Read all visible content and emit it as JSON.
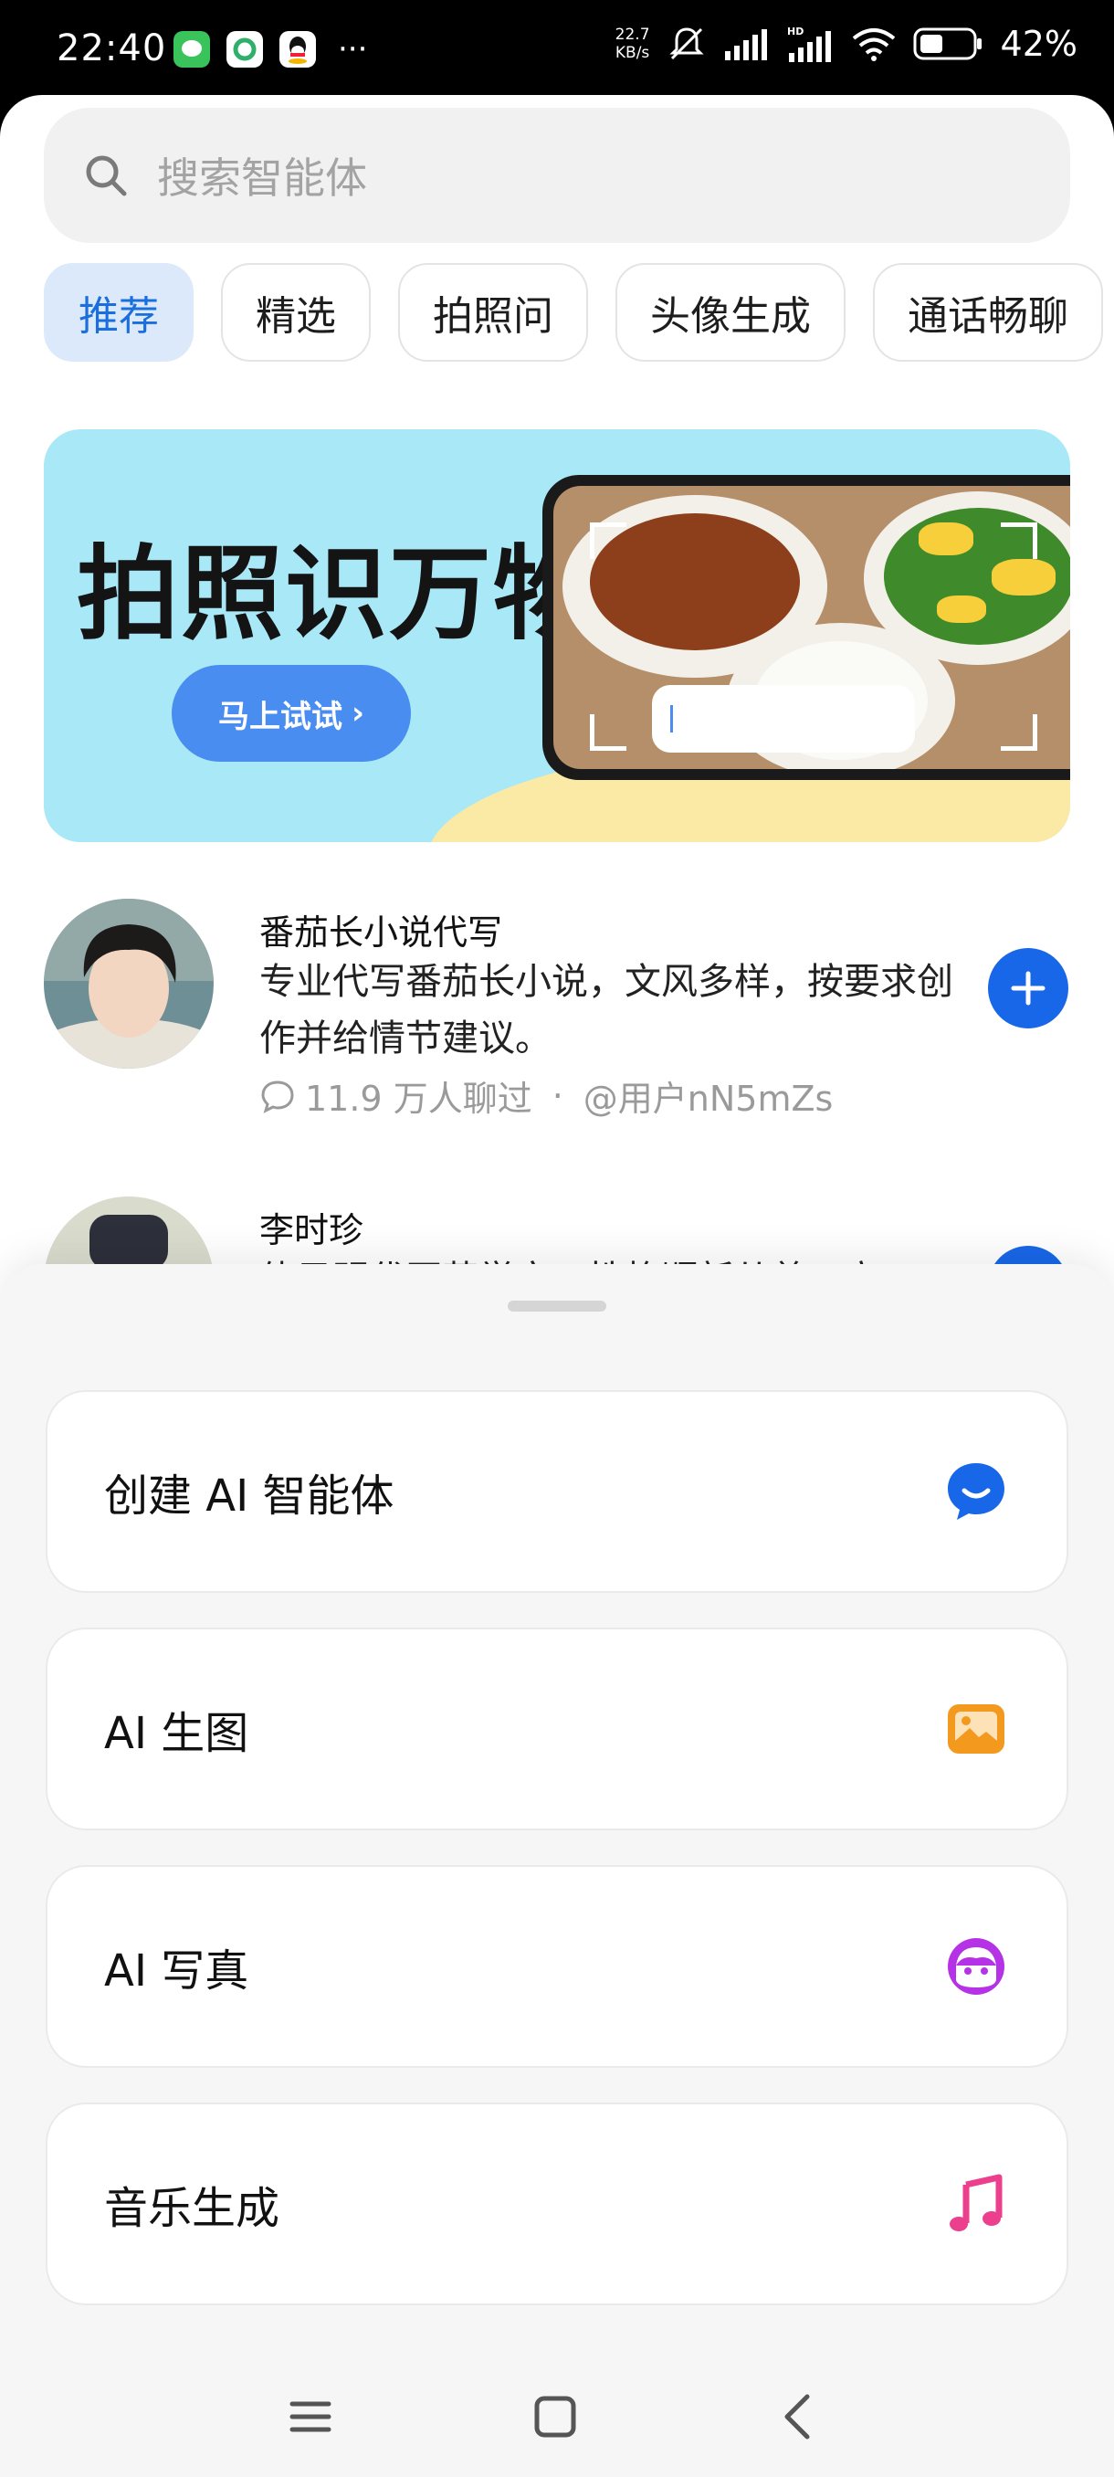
{
  "status_bar": {
    "time": "22:40",
    "more": "···",
    "net_speed_value": "22.7",
    "net_speed_unit": "KB/s",
    "battery": "42%",
    "icons": [
      "wechat-icon",
      "green-app-icon",
      "qq-icon",
      "mute-icon",
      "signal-icon",
      "hd-signal-icon",
      "wifi-icon",
      "battery-icon"
    ]
  },
  "search": {
    "placeholder": "搜索智能体"
  },
  "tabs": [
    {
      "label": "推荐",
      "active": true
    },
    {
      "label": "精选",
      "active": false
    },
    {
      "label": "拍照问",
      "active": false
    },
    {
      "label": "头像生成",
      "active": false
    },
    {
      "label": "通话畅聊",
      "active": false
    }
  ],
  "banner": {
    "title": "拍照识万物",
    "button_label": "马上试试",
    "button_chevron": "›"
  },
  "agents": [
    {
      "name": "番茄长小说代写",
      "description": "专业代写番茄长小说，文风多样，按要求创作并给情节建议。",
      "chats": "11.9 万人聊过",
      "separator": "·",
      "author": "@用户nN5mZs"
    },
    {
      "name": "李时珍",
      "description": "体目明代医药学家，性格顺新从尊，立"
    }
  ],
  "sheet": {
    "options": [
      {
        "label": "创建 AI 智能体",
        "icon": "chat-bubble-icon",
        "color": "#1867e8"
      },
      {
        "label": "AI 生图",
        "icon": "image-icon",
        "color": "#f39a1e"
      },
      {
        "label": "AI 写真",
        "icon": "face-icon",
        "color": "#b532e6"
      },
      {
        "label": "音乐生成",
        "icon": "music-note-icon",
        "color": "#ec3f8e"
      }
    ]
  },
  "nav_bar": {
    "buttons": [
      "menu-icon",
      "home-icon",
      "back-icon"
    ]
  }
}
